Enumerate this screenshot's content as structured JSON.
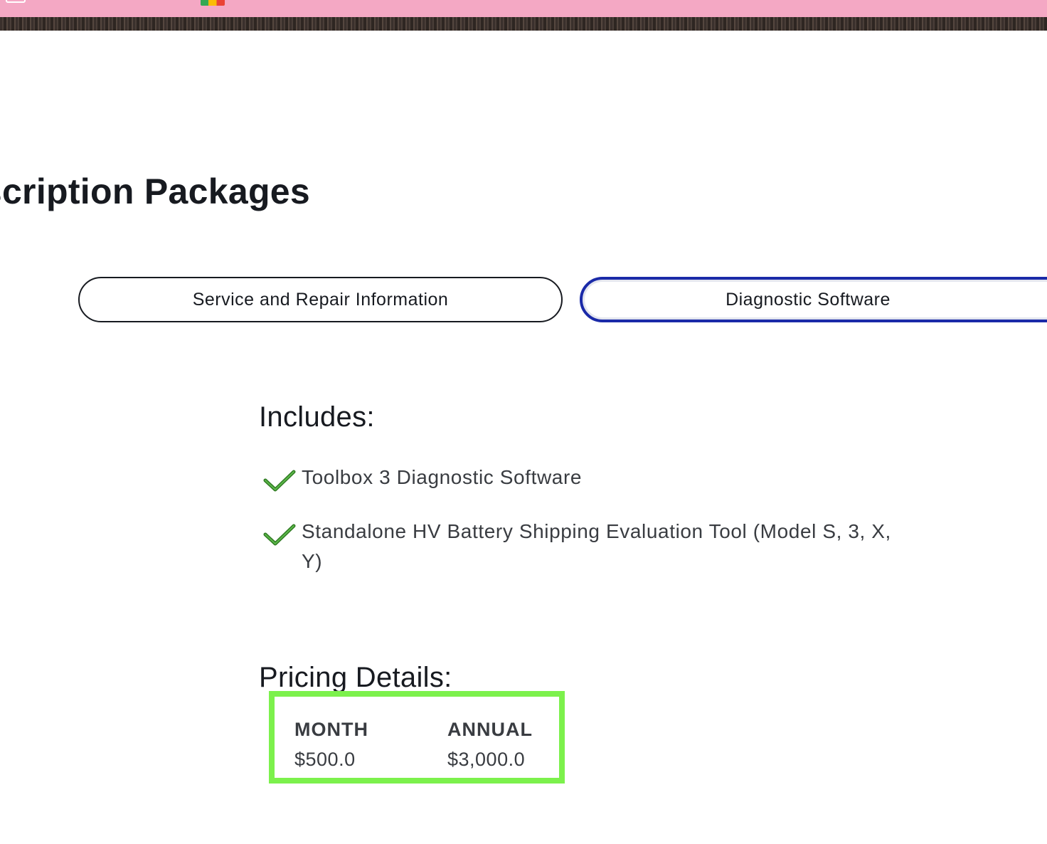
{
  "page": {
    "title": "bscription Packages"
  },
  "tabs": [
    {
      "label": "Service and Repair Information",
      "selected": false
    },
    {
      "label": "Diagnostic Software",
      "selected": true
    }
  ],
  "includes": {
    "heading": "Includes:",
    "items": [
      {
        "icon": "checkmark-icon",
        "text": "Toolbox 3 Diagnostic Software"
      },
      {
        "icon": "checkmark-icon",
        "text": "Standalone HV Battery Shipping Evaluation Tool (Model S, 3, X, Y)"
      }
    ]
  },
  "pricing": {
    "heading": "Pricing Details:",
    "month_label": "MONTH",
    "month_value": "$500.0",
    "annual_label": "ANNUAL",
    "annual_value": "$3,000.0",
    "highlight_color": "#7cf14c"
  },
  "colors": {
    "topbar": "#f4a8c4",
    "selected_tab_border": "#1a2aa8",
    "check": "#3f9a2e",
    "text": "#171a20"
  }
}
